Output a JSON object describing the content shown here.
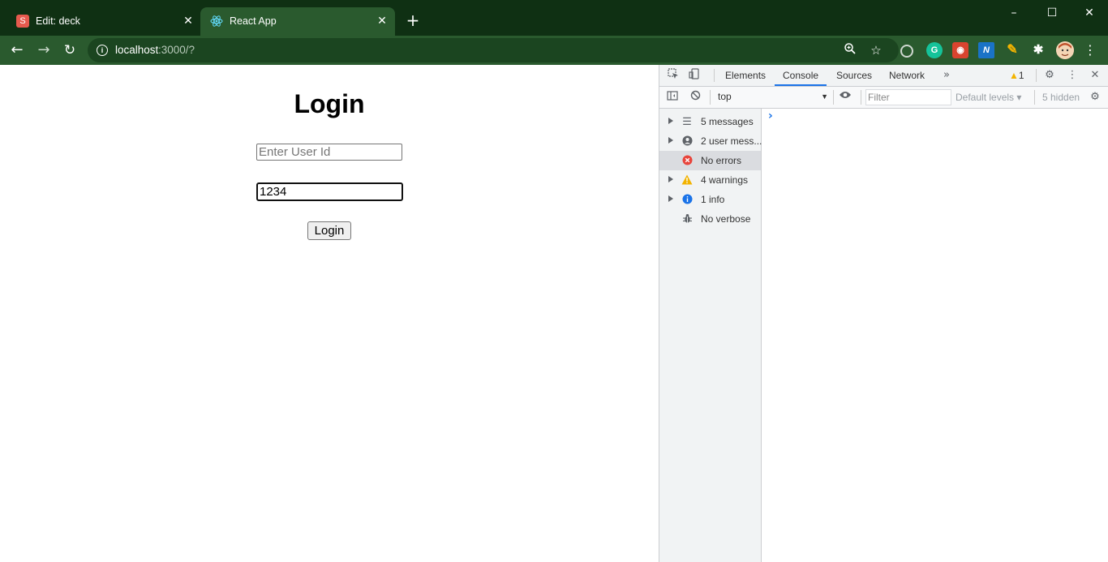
{
  "browser": {
    "tabs": [
      {
        "title": "Edit: deck",
        "favicon_letter": "S"
      },
      {
        "title": "React App"
      }
    ],
    "url_host": "localhost",
    "url_path": ":3000/?"
  },
  "page": {
    "title": "Login",
    "userid_placeholder": "Enter User Id",
    "password_value": "1234",
    "login_button": "Login"
  },
  "devtools": {
    "tabs": [
      "Elements",
      "Console",
      "Sources",
      "Network"
    ],
    "active_tab": "Console",
    "warning_count": "1",
    "context": "top",
    "filter_placeholder": "Filter",
    "levels_label": "Default levels ▾",
    "hidden_label": "5 hidden",
    "sidebar": [
      {
        "label": "5 messages",
        "icon": "list-icon"
      },
      {
        "label": "2 user mess...",
        "icon": "user-icon"
      },
      {
        "label": "No errors",
        "icon": "error-icon"
      },
      {
        "label": "4 warnings",
        "icon": "warning-icon"
      },
      {
        "label": "1 info",
        "icon": "info-icon"
      },
      {
        "label": "No verbose",
        "icon": "bug-icon"
      }
    ]
  },
  "colors": {
    "chrome_frame": "#0f3013",
    "chrome_toolbar": "#2a5a2e",
    "devtools_accent": "#1a73e8"
  }
}
